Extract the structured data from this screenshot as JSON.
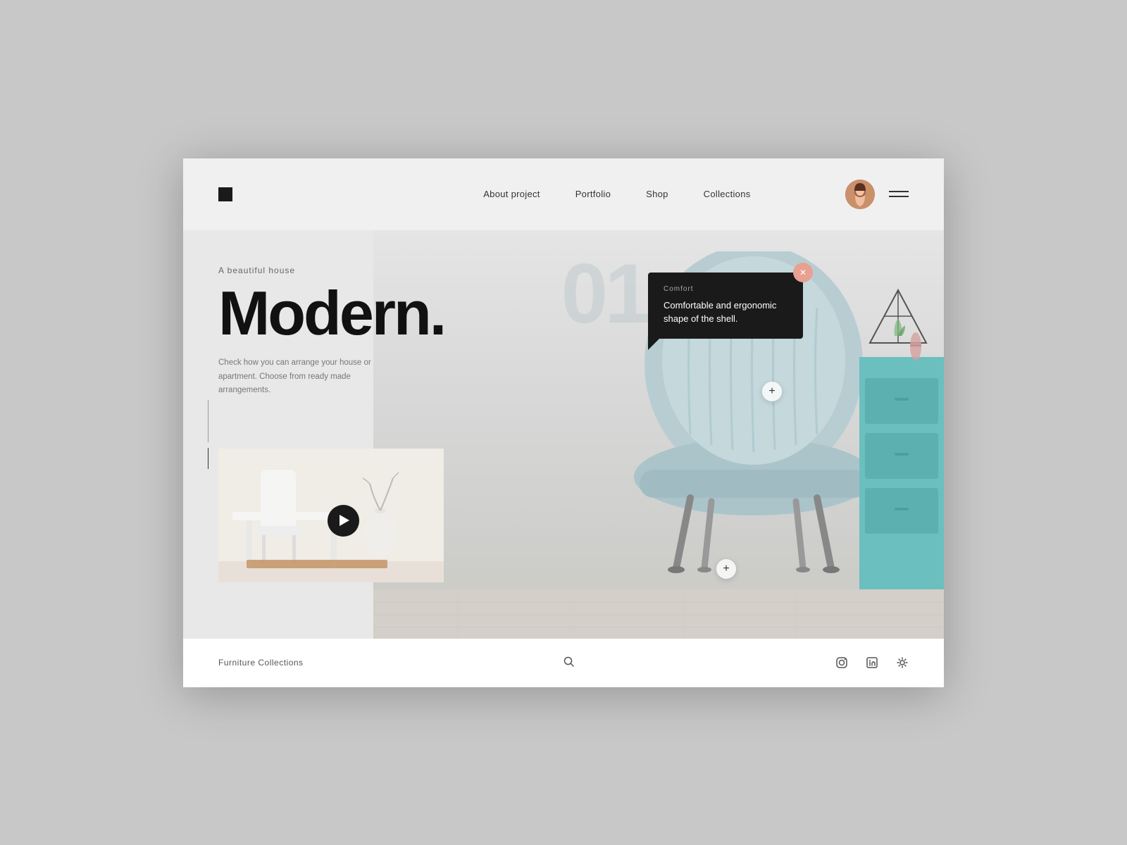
{
  "header": {
    "nav": {
      "items": [
        {
          "id": "about",
          "label": "About project"
        },
        {
          "id": "portfolio",
          "label": "Portfolio"
        },
        {
          "id": "shop",
          "label": "Shop"
        },
        {
          "id": "collections",
          "label": "Collections"
        }
      ]
    }
  },
  "hero": {
    "subtitle": "A beautiful house",
    "title": "Modern.",
    "description": "Check how you can arrange your house\nor apartment. Choose from ready\nmade arrangements.",
    "number": "01",
    "tooltip": {
      "label": "Comfort",
      "text": "Comfortable and ergonomic\nshape of the shell."
    },
    "plus_label": "+"
  },
  "footer": {
    "brand": "Furniture Collections",
    "icons": {
      "instagram": "instagram-icon",
      "linkedin": "linkedin-icon",
      "settings": "settings-icon"
    }
  }
}
